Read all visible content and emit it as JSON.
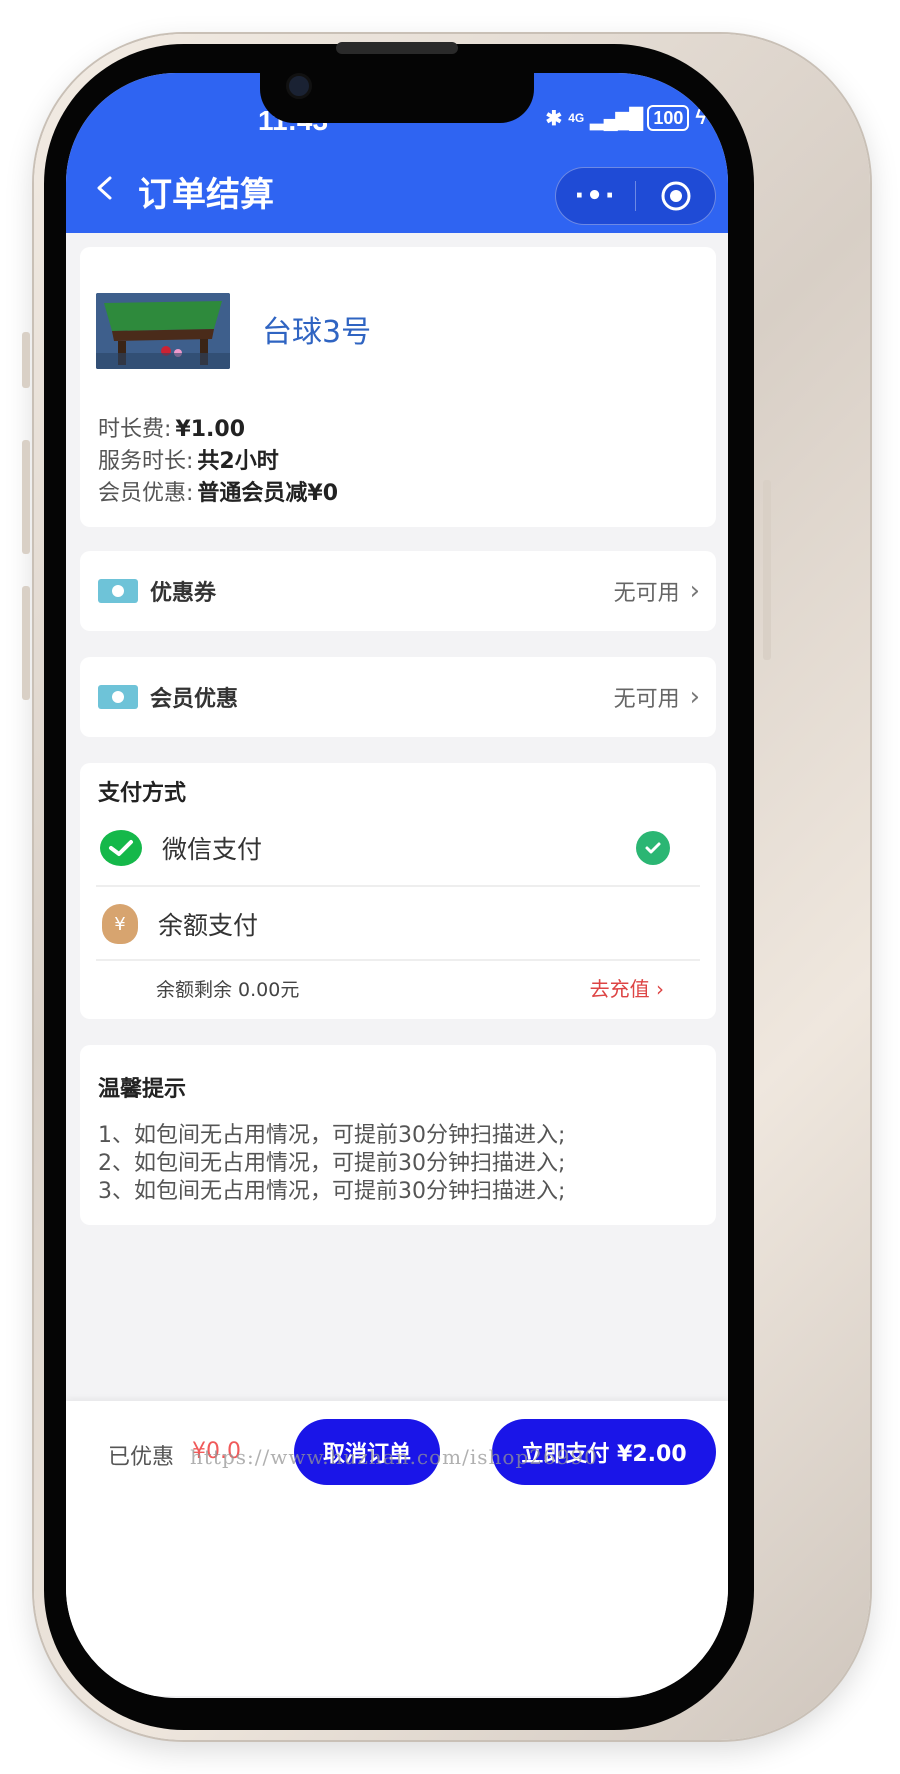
{
  "status_bar": {
    "time": "11:43",
    "network": "4G",
    "battery": "100"
  },
  "nav": {
    "title": "订单结算"
  },
  "product": {
    "name": "台球3号",
    "duration_fee_label": "时长费:",
    "duration_fee_value": "¥1.00",
    "service_time_label": "服务时长:",
    "service_time_value": "共2小时",
    "member_discount_label": "会员优惠:",
    "member_discount_value": "普通会员减¥0"
  },
  "coupon": {
    "label": "优惠券",
    "value": "无可用"
  },
  "member_offer": {
    "label": "会员优惠",
    "value": "无可用"
  },
  "payment": {
    "title": "支付方式",
    "wechat_label": "微信支付",
    "balance_label": "余额支付",
    "balance_remaining": "余额剩余 0.00元",
    "recharge_label": "去充值 ›",
    "selected": "wechat"
  },
  "tips": {
    "title": "温馨提示",
    "lines": [
      "1、如包间无占用情况，可提前30分钟扫描进入;",
      "2、如包间无占用情况，可提前30分钟扫描进入;",
      "3、如包间无占用情况，可提前30分钟扫描进入;"
    ]
  },
  "bottom": {
    "discount_label": "已优惠",
    "discount_value": "¥0.0",
    "cancel_label": "取消订单",
    "pay_label": "立即支付  ¥2.00",
    "watermark": "https://www.huzhan.com/ishop26990"
  },
  "colors": {
    "header": "#2f64f2",
    "button": "#1a15e8",
    "accent_red": "#d44444",
    "wechat_green": "#15b84a"
  }
}
